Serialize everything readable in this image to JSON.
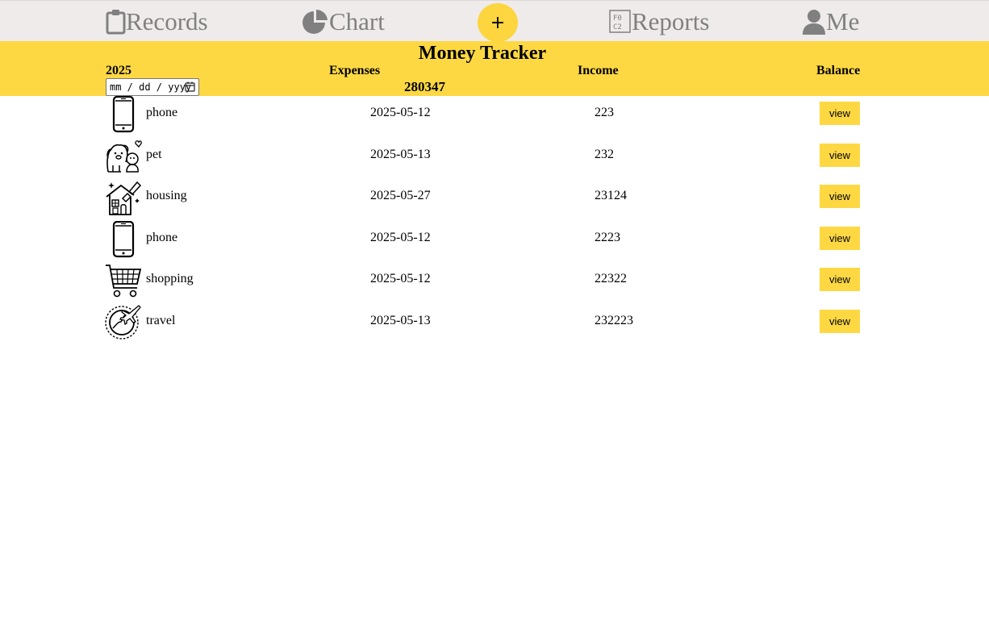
{
  "nav": {
    "records_label": "Records",
    "chart_label": "Chart",
    "add_label": "+",
    "reports_label": "Reports",
    "me_label": "Me"
  },
  "header": {
    "title": "Money Tracker",
    "year": "2025",
    "expenses_label": "Expenses",
    "income_label": "Income",
    "balance_label": "Balance",
    "expenses_total": "280347",
    "date_placeholder": "mm / dd / yyyy"
  },
  "records": [
    {
      "category": "phone",
      "icon": "phone-icon",
      "date": "2025-05-12",
      "amount": "223",
      "action": "view"
    },
    {
      "category": "pet",
      "icon": "pet-icon",
      "date": "2025-05-13",
      "amount": "232",
      "action": "view"
    },
    {
      "category": "housing",
      "icon": "housing-icon",
      "date": "2025-05-27",
      "amount": "23124",
      "action": "view"
    },
    {
      "category": "phone",
      "icon": "phone-icon",
      "date": "2025-05-12",
      "amount": "2223",
      "action": "view"
    },
    {
      "category": "shopping",
      "icon": "shopping-cart-icon",
      "date": "2025-05-12",
      "amount": "22322",
      "action": "view"
    },
    {
      "category": "travel",
      "icon": "travel-icon",
      "date": "2025-05-13",
      "amount": "232223",
      "action": "view"
    }
  ],
  "colors": {
    "accent": "#fdd843",
    "nav_bg": "#efebea",
    "nav_text": "#808080"
  }
}
